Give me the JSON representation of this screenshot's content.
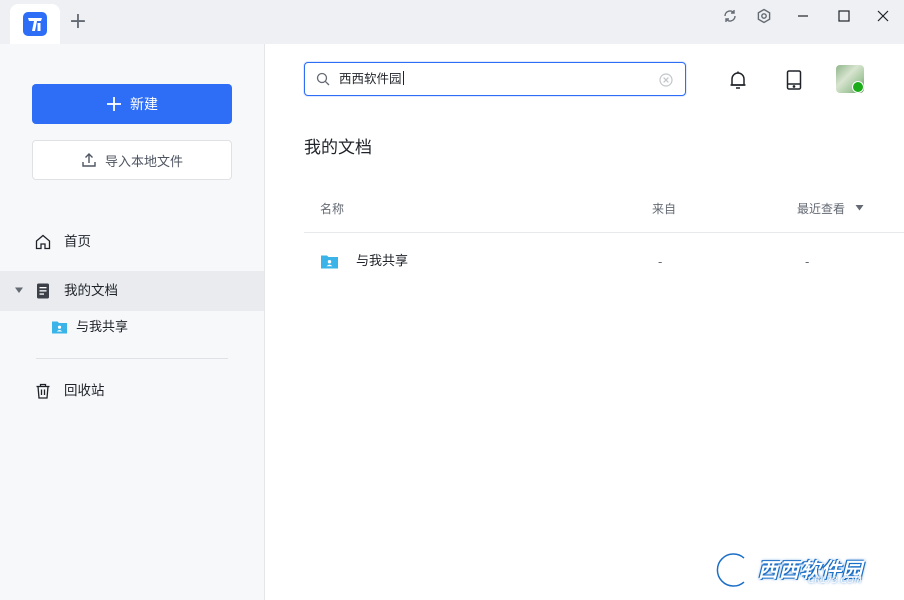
{
  "titlebar": {
    "add_tab_symbol": "+",
    "icons": [
      "sync-icon",
      "settings-icon",
      "minimize-icon",
      "maximize-icon",
      "close-icon"
    ]
  },
  "sidebar": {
    "new_button_label": "新建",
    "import_button_label": "导入本地文件",
    "nav": {
      "home": "首页",
      "my_docs": "我的文档",
      "shared_with_me": "与我共享",
      "recycle_bin": "回收站"
    }
  },
  "search": {
    "value": "西西软件园",
    "placeholder": ""
  },
  "main": {
    "title": "我的文档",
    "columns": {
      "name": "名称",
      "from": "来自",
      "last_viewed": "最近查看"
    },
    "rows": [
      {
        "name": "与我共享",
        "from": "-",
        "last_viewed": "-"
      }
    ]
  },
  "watermark": {
    "text": "西西软件园",
    "sub": "CR173.COM"
  },
  "colors": {
    "accent": "#2e6df6",
    "sidebar_bg": "#f7f8fa",
    "titlebar_bg": "#eef0f3",
    "folder_shared": "#3ab4e8"
  }
}
